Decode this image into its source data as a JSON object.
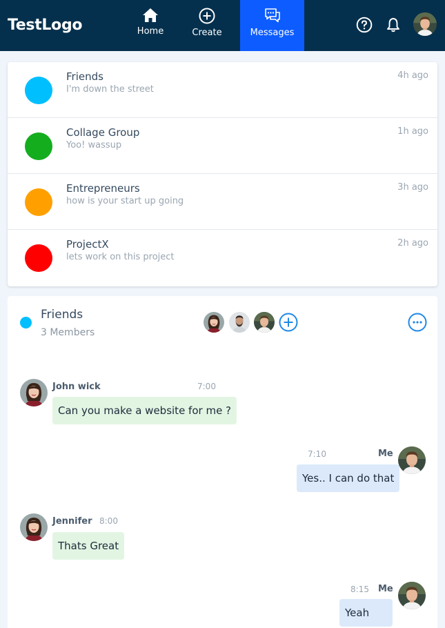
{
  "header": {
    "logo": "TestLogo",
    "nav": [
      {
        "label": "Home",
        "icon": "home-icon"
      },
      {
        "label": "Create",
        "icon": "plus-circle-icon"
      },
      {
        "label": "Messages",
        "icon": "chat-bubbles-icon",
        "active": true
      }
    ],
    "icons": [
      "help-icon",
      "bell-icon"
    ],
    "colors": {
      "background": "#05304d",
      "active_tab": "#0d5cff"
    }
  },
  "conversations": [
    {
      "name": "Friends",
      "last_message": "I'm down the street",
      "time": "4h ago",
      "color": "#00bfff"
    },
    {
      "name": "Collage Group",
      "last_message": "Yoo! wassup",
      "time": "1h ago",
      "color": "#14ad1e"
    },
    {
      "name": "Entrepreneurs",
      "last_message": "how is your start up going",
      "time": "3h ago",
      "color": "#ffa000"
    },
    {
      "name": "ProjectX",
      "last_message": "lets work on this project",
      "time": "2h ago",
      "color": "#ff0000"
    }
  ],
  "chat": {
    "title": "Friends",
    "members": "3 Members",
    "color": "#00bfff",
    "messages": [
      {
        "sender": "John wick",
        "time": "7:00",
        "text": "Can you make a website for me ?",
        "direction": "in"
      },
      {
        "sender": "Me",
        "time": "7:10",
        "text": "Yes.. I can do that",
        "direction": "out"
      },
      {
        "sender": "Jennifer",
        "time": "8:00",
        "text": "Thats Great",
        "direction": "in"
      },
      {
        "sender": "Me",
        "time": "8:15",
        "text": "Yeah",
        "direction": "out"
      }
    ]
  }
}
